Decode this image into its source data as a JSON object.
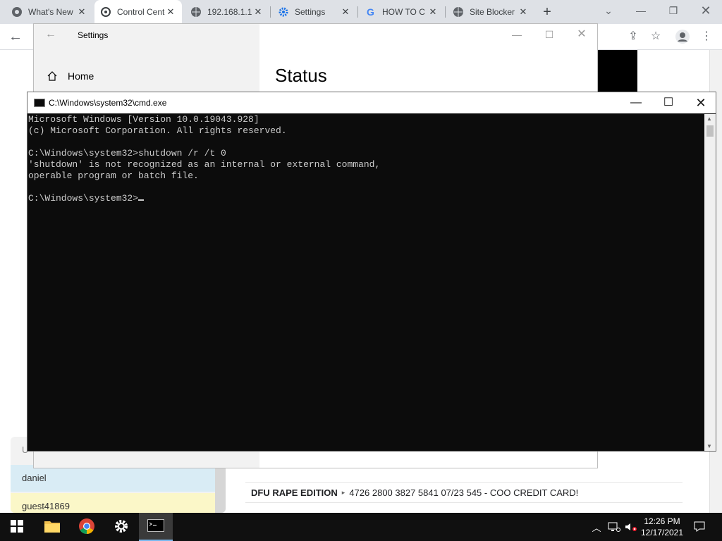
{
  "browser": {
    "tabs": [
      {
        "title": "What's New",
        "icon": "chrome-icon"
      },
      {
        "title": "Control Center",
        "icon": "control-center-icon"
      },
      {
        "title": "192.168.1.1",
        "icon": "globe-icon"
      },
      {
        "title": "Settings",
        "icon": "gear-icon"
      },
      {
        "title": "HOW TO C",
        "icon": "google-icon"
      },
      {
        "title": "Site Blocker",
        "icon": "globe-icon"
      }
    ],
    "new_tab": "+",
    "tab_close": "✕"
  },
  "settings_window": {
    "title": "Settings",
    "nav_home": "Home",
    "heading": "Status"
  },
  "cmd_window": {
    "title": "C:\\Windows\\system32\\cmd.exe",
    "lines": [
      "Microsoft Windows [Version 10.0.19043.928]",
      "(c) Microsoft Corporation. All rights reserved.",
      "",
      "C:\\Windows\\system32>shutdown /r /t 0",
      "'shutdown' is not recognized as an internal or external command,",
      "operable program or batch file.",
      "",
      "C:\\Windows\\system32>"
    ]
  },
  "background_page": {
    "users": [
      "daniel",
      "guest41869"
    ],
    "user_header": "U",
    "chat": {
      "name": "DFU RAPE EDITION",
      "message": "4726 2800 3827 5841 07/23 545 - COO CREDIT CARD!"
    }
  },
  "taskbar": {
    "time": "12:26 PM",
    "date": "12/17/2021"
  },
  "colors": {
    "console_bg": "#0c0c0c",
    "console_text": "#cccccc",
    "taskbar": "#101010"
  }
}
